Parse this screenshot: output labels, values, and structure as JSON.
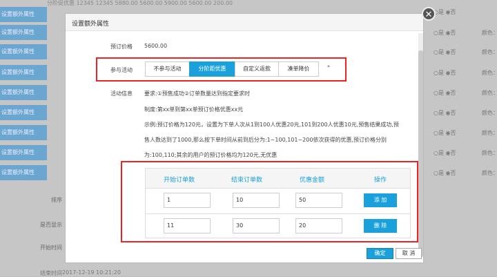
{
  "background": {
    "top_row": "分阶促优惠   12345   12345   5880.00   5600.00   5900.00          5600.00                                 200.00",
    "side_button_label": "设置额外属性",
    "radio_text": "○是 ◉否",
    "color_text": "颜色：",
    "form_labels": [
      "排序",
      "是否显示",
      "开始时间",
      "结束时间"
    ],
    "end_time_value": "2017-12-19 10:21:20"
  },
  "modal": {
    "title": "设置额外属性",
    "close_symbol": "✕",
    "order_price_label": "预订价格",
    "order_price_value": "5600.00",
    "activity_label": "参与活动",
    "activity_options": [
      "不参与活动",
      "分阶距优惠",
      "自定义返款",
      "凑单降价"
    ],
    "activity_selected": "分阶距优惠",
    "required_mark": "*",
    "info_label": "活动信息",
    "info_lines": [
      "要求:①预售成功②订单数量达到指定要求时",
      "制度:第xx单到第xx单预订价格优惠xx元",
      "示例:预订价格为120元，设置为下单人次从1到100人优惠20元,101到200人优惠10元,预售结果成功,预",
      "售人数达到了1000,那么按下单时间从前到后分为:1~100,101~200依次获得的优惠,预订价格分别",
      "为:100,110;其余的用户的预订价格均为120元,无优惠"
    ],
    "tier_table": {
      "headers": [
        "开始订单数",
        "结束订单数",
        "优惠金额",
        "操作"
      ],
      "rows": [
        {
          "start": "1",
          "end": "10",
          "discount": "50",
          "action": "添 加"
        },
        {
          "start": "11",
          "end": "30",
          "discount": "20",
          "action": "删 除"
        }
      ]
    },
    "ok_label": "确定",
    "cancel_label": "取 消"
  },
  "colors": {
    "accent": "#1aa1dc",
    "highlight_border": "#e22222"
  }
}
